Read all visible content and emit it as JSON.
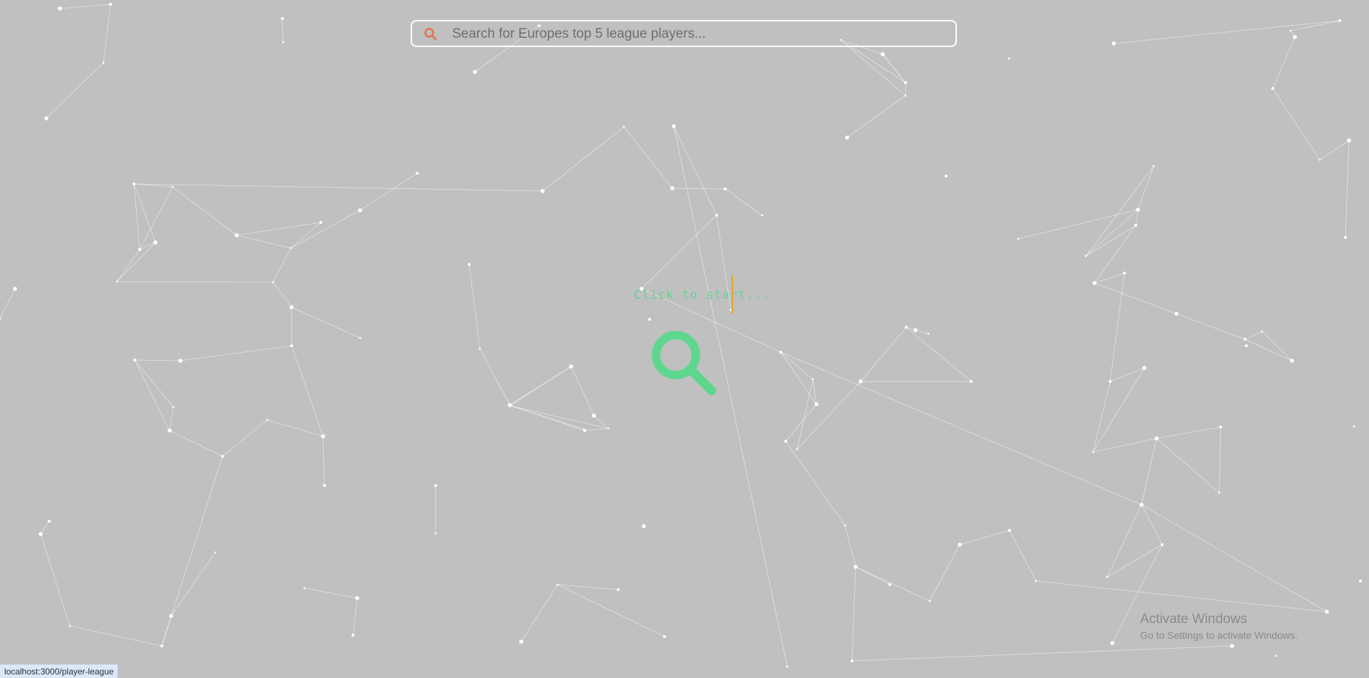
{
  "search": {
    "placeholder": "Search for Europes top 5 league players...",
    "value": ""
  },
  "prompt": {
    "text": "Click to start..."
  },
  "status_bar": {
    "url": "localhost:3000/player-league"
  },
  "os_watermark": {
    "title": "Activate Windows",
    "subtitle": "Go to Settings to activate Windows."
  },
  "colors": {
    "background": "#c0c0c0",
    "accent_green": "#5fd68e",
    "search_icon_orange": "#e0744f",
    "caret_orange": "#e3a52d",
    "particle_white": "#ffffff"
  },
  "icons": {
    "searchbar_icon": "search-icon",
    "center_icon": "search-icon"
  }
}
